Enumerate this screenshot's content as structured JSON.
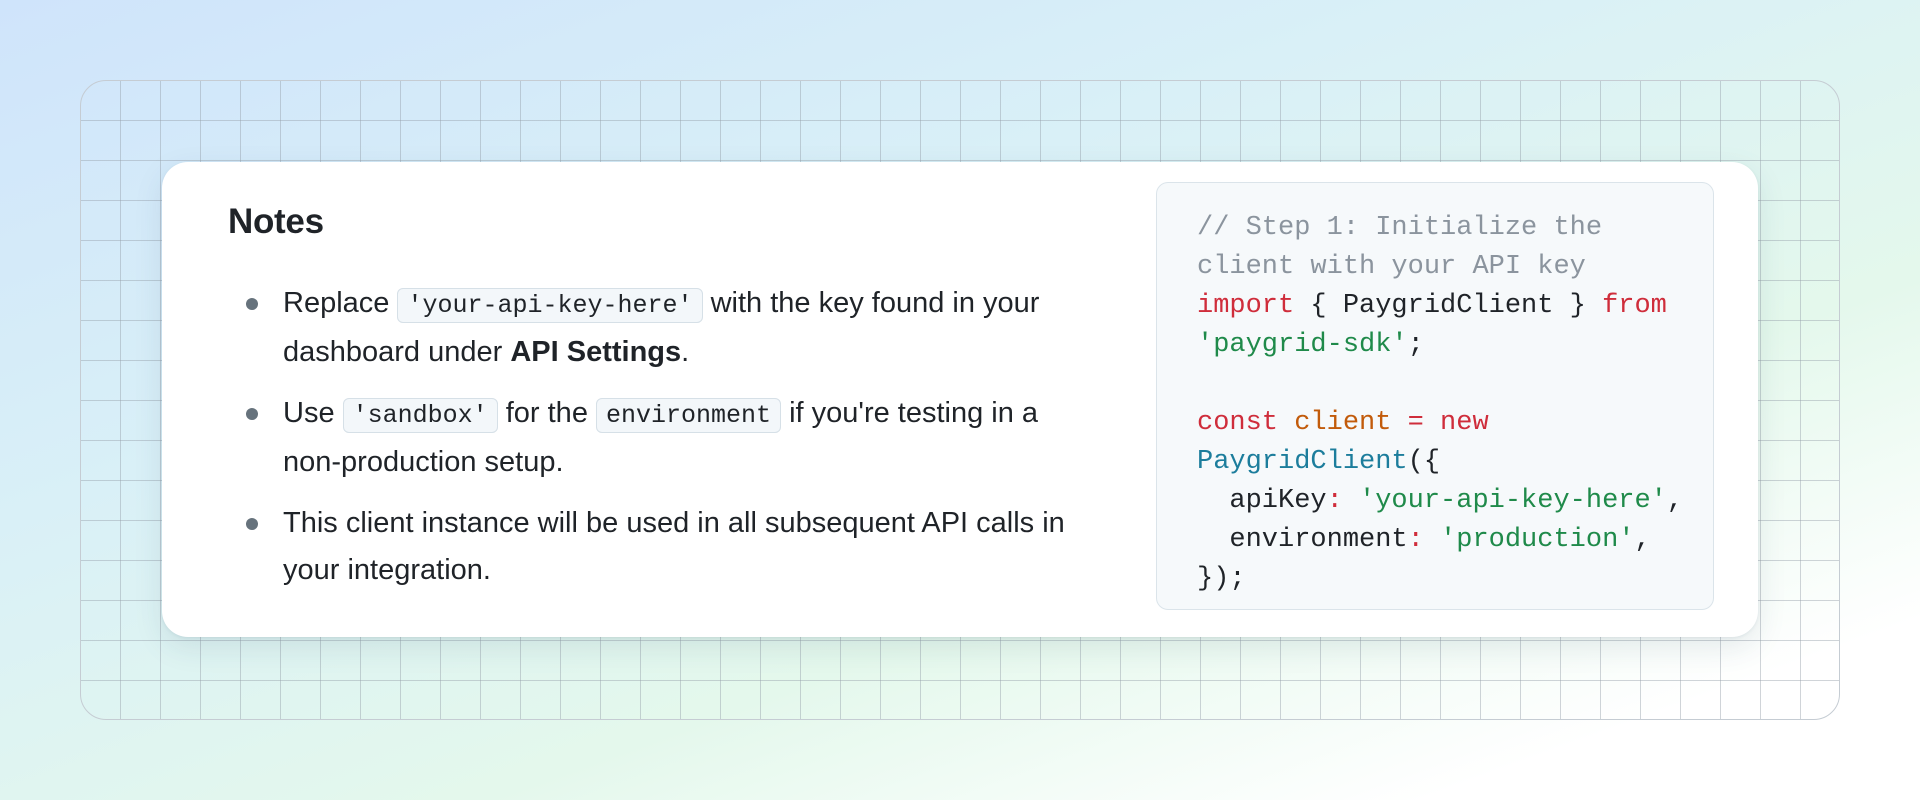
{
  "notes": {
    "title": "Notes",
    "items": [
      {
        "before": "Replace ",
        "code": "'your-api-key-here'",
        "middle": " with the key found in your dashboard under ",
        "bold": "API Settings",
        "after": "."
      },
      {
        "before": "Use ",
        "code1": "'sandbox'",
        "middle": " for the ",
        "code2": "environment",
        "after": " if you're testing in a non-production setup."
      },
      {
        "text": "This client instance will be used in all subsequent API calls in your integration."
      }
    ]
  },
  "code": {
    "comment1": "// Step 1: Initialize the",
    "comment2": "client with your API key",
    "kw_import": "import",
    "import_names": " { PaygridClient } ",
    "kw_from": "from",
    "module": "'paygrid-sdk'",
    "semi": ";",
    "kw_const": "const",
    "var_client": "client",
    "op_eq": "=",
    "kw_new": "new",
    "class_name": "PaygridClient",
    "open": "({",
    "key_apiKey": "  apiKey",
    "colon": ":",
    "val_apiKey": "'your-api-key-here'",
    "comma": ",",
    "key_env": "  environment",
    "val_env": "'production'",
    "close": "});"
  },
  "colors": {
    "keyword": "#cf2d3b",
    "string": "#1f8a4a",
    "comment": "#8b949e",
    "variable": "#c25b0b",
    "class": "#1c7d9c"
  }
}
